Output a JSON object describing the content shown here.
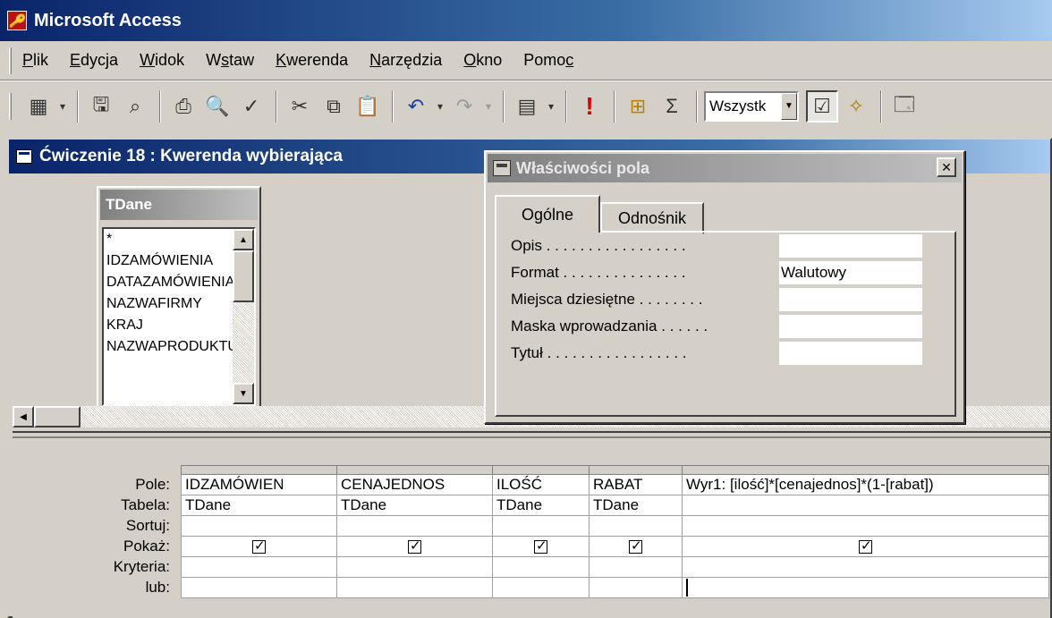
{
  "app": {
    "title": "Microsoft Access"
  },
  "menu": {
    "items": [
      {
        "pre": "",
        "u": "P",
        "post": "lik"
      },
      {
        "pre": "",
        "u": "E",
        "post": "dycja"
      },
      {
        "pre": "",
        "u": "W",
        "post": "idok"
      },
      {
        "pre": "W",
        "u": "s",
        "post": "taw"
      },
      {
        "pre": "",
        "u": "K",
        "post": "werenda"
      },
      {
        "pre": "",
        "u": "N",
        "post": "arzędzia"
      },
      {
        "pre": "",
        "u": "O",
        "post": "kno"
      },
      {
        "pre": "Pomo",
        "u": "c",
        "post": ""
      }
    ]
  },
  "toolbar": {
    "icons": {
      "view": "▦",
      "save": "🖫",
      "search": "⌕",
      "print": "⎙",
      "preview": "🔍",
      "spell": "✓",
      "cut": "✂",
      "copy": "⧉",
      "paste": "📋",
      "undo": "↶",
      "redo": "↷",
      "querytype": "▤",
      "run": "!",
      "showtable": "⊞",
      "totals": "Σ",
      "properties": "☑",
      "build": "✧",
      "db": "🗔"
    },
    "topvalues": "Wszystk"
  },
  "query_window": {
    "title": "Ćwiczenie 18 : Kwerenda wybierająca",
    "table": {
      "name": "TDane",
      "fields": [
        "*",
        "IDZAMÓWIENIA",
        "DATAZAMÓWIENIA",
        "NAZWAFIRMY",
        "KRAJ",
        "NAZWAPRODUKTU"
      ]
    },
    "grid": {
      "row_labels": [
        "Pole:",
        "Tabela:",
        "Sortuj:",
        "Pokaż:",
        "Kryteria:",
        "lub:"
      ],
      "columns": [
        {
          "field": "IDZAMÓWIEN",
          "table": "TDane"
        },
        {
          "field": "CENAJEDNOS",
          "table": "TDane"
        },
        {
          "field": "ILOŚĆ",
          "table": "TDane"
        },
        {
          "field": "RABAT",
          "table": "TDane"
        },
        {
          "field": "Wyr1: [ilość]*[cenajednos]*(1-[rabat])",
          "table": ""
        }
      ]
    }
  },
  "properties": {
    "title": "Właściwości pola",
    "tabs": [
      "Ogólne",
      "Odnośnik"
    ],
    "rows": [
      {
        "label": "Opis . . . . . . . . . . . . . . . . .",
        "value": ""
      },
      {
        "label": "Format . . . . . . . . . . . . . . .",
        "value": "Walutowy"
      },
      {
        "label": "Miejsca dziesiętne . . . . . . . .",
        "value": ""
      },
      {
        "label": "Maska wprowadzania . . . . . .",
        "value": ""
      },
      {
        "label": "Tytuł . . . . . . . . . . . . . . . . .",
        "value": ""
      }
    ]
  }
}
